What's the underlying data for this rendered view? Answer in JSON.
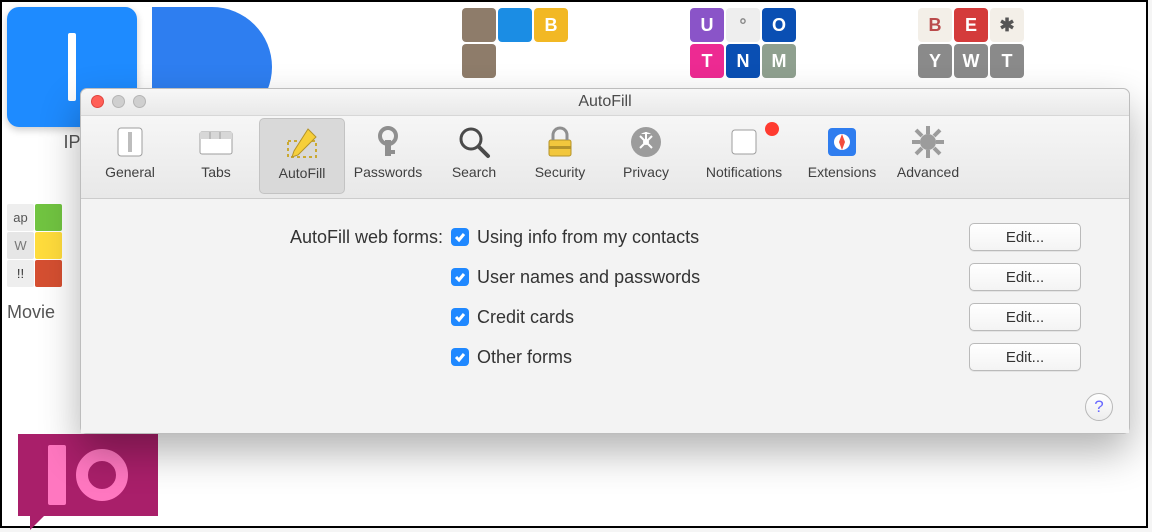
{
  "desktop": {
    "ip_label": "IP",
    "movies_label": "Movie",
    "grid1": [
      {
        "bg": "#8e7c6a",
        "fg": "#fff",
        "t": ""
      },
      {
        "bg": "#1b8de4",
        "fg": "#fff",
        "t": ""
      },
      {
        "bg": "#f2b824",
        "fg": "#fff",
        "t": "B"
      },
      {
        "bg": "#8e7c6a",
        "fg": "#fff",
        "t": ""
      }
    ],
    "grid2": [
      {
        "bg": "#8a54c8",
        "fg": "#fff",
        "t": "U"
      },
      {
        "bg": "#eeeeee",
        "fg": "#888",
        "t": "°"
      },
      {
        "bg": "#0a4fb3",
        "fg": "#fff",
        "t": "O"
      },
      {
        "bg": "#ed2a92",
        "fg": "#fff",
        "t": "T"
      },
      {
        "bg": "#0a4fb3",
        "fg": "#fff",
        "t": "N"
      },
      {
        "bg": "#8fa08f",
        "fg": "#fff",
        "t": "M"
      }
    ],
    "grid3": [
      {
        "bg": "#f3efe8",
        "fg": "#ba4b4b",
        "t": "B"
      },
      {
        "bg": "#d43b3b",
        "fg": "#fff",
        "t": "E"
      },
      {
        "bg": "#f3efe8",
        "fg": "#555",
        "t": "✱"
      },
      {
        "bg": "#8a8a8a",
        "fg": "#fff",
        "t": "Y"
      },
      {
        "bg": "#8a8a8a",
        "fg": "#fff",
        "t": "W"
      },
      {
        "bg": "#8a8a8a",
        "fg": "#fff",
        "t": "T"
      }
    ],
    "movies_tiles": [
      [
        {
          "bg": "#eee",
          "fg": "#555",
          "t": "ap"
        },
        {
          "bg": "#71c441",
          "fg": "#fff",
          "t": ""
        }
      ],
      [
        {
          "bg": "#e6e6e6",
          "fg": "#777",
          "t": "W"
        },
        {
          "bg": "#ffdc3c",
          "fg": "#444",
          "t": ""
        }
      ],
      [
        {
          "bg": "#eee",
          "fg": "#333",
          "t": "!!"
        },
        {
          "bg": "#d54f31",
          "fg": "#fff",
          "t": ""
        }
      ]
    ]
  },
  "window": {
    "title": "AutoFill",
    "toolbar": [
      {
        "key": "general",
        "label": "General"
      },
      {
        "key": "tabs",
        "label": "Tabs"
      },
      {
        "key": "autofill",
        "label": "AutoFill"
      },
      {
        "key": "passwords",
        "label": "Passwords"
      },
      {
        "key": "search",
        "label": "Search"
      },
      {
        "key": "security",
        "label": "Security"
      },
      {
        "key": "privacy",
        "label": "Privacy"
      },
      {
        "key": "notifications",
        "label": "Notifications"
      },
      {
        "key": "extensions",
        "label": "Extensions"
      },
      {
        "key": "advanced",
        "label": "Advanced"
      }
    ],
    "selected_tab_key": "autofill",
    "notification_badge_on": "notifications",
    "section_label": "AutoFill web forms:",
    "options": [
      {
        "label": "Using info from my contacts",
        "checked": true,
        "edit": "Edit..."
      },
      {
        "label": "User names and passwords",
        "checked": true,
        "edit": "Edit..."
      },
      {
        "label": "Credit cards",
        "checked": true,
        "edit": "Edit..."
      },
      {
        "label": "Other forms",
        "checked": true,
        "edit": "Edit..."
      }
    ],
    "help_glyph": "?"
  }
}
